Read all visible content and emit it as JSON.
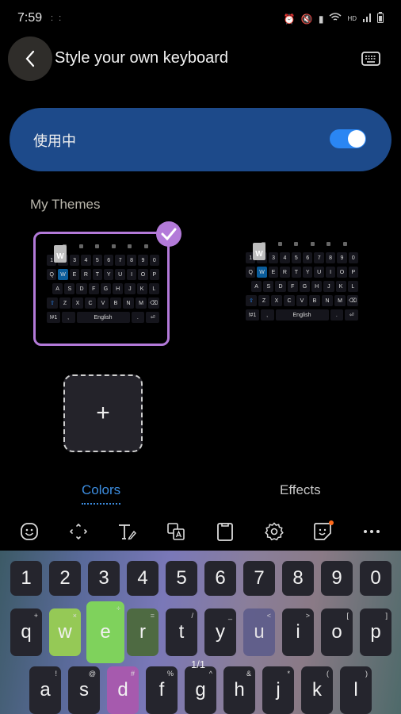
{
  "status_bar": {
    "time": "7:59",
    "notification_dots": ": :",
    "icons": [
      "alarm-icon",
      "mute-icon",
      "battery-saver-icon",
      "wifi-icon",
      "hd-icon",
      "signal-icon",
      "battery-icon"
    ],
    "hd_label": "HD"
  },
  "app_bar": {
    "title": "Style your own keyboard",
    "back_icon": "chevron-left-icon",
    "right_icon": "keyboard-icon"
  },
  "toggle": {
    "label": "使用中",
    "on": true
  },
  "my_themes": {
    "label": "My Themes",
    "themes": [
      {
        "selected": true,
        "popup_key": "W"
      },
      {
        "selected": false,
        "popup_key": "W"
      }
    ],
    "add_label": "+"
  },
  "mini_keyboard": {
    "rows": [
      [
        "1",
        "2",
        "3",
        "4",
        "5",
        "6",
        "7",
        "8",
        "9",
        "0"
      ],
      [
        "Q",
        "W",
        "E",
        "R",
        "T",
        "Y",
        "U",
        "I",
        "O",
        "P"
      ],
      [
        "A",
        "S",
        "D",
        "F",
        "G",
        "H",
        "J",
        "K",
        "L"
      ],
      [
        "⇧",
        "Z",
        "X",
        "C",
        "V",
        "B",
        "N",
        "M",
        "⌫"
      ],
      [
        "!#1",
        ",",
        "English",
        ".",
        "⏎"
      ]
    ]
  },
  "tabs": [
    {
      "label": "Colors",
      "active": true
    },
    {
      "label": "Effects",
      "active": false
    }
  ],
  "keyboard_toolbar": {
    "icons": [
      "emoji-icon",
      "cursor-move-icon",
      "text-edit-icon",
      "translate-icon",
      "clipboard-icon",
      "settings-icon",
      "sticker-icon",
      "more-icon"
    ]
  },
  "keyboard": {
    "number_row": [
      "1",
      "2",
      "3",
      "4",
      "5",
      "6",
      "7",
      "8",
      "9",
      "0"
    ],
    "row1": [
      {
        "key": "q",
        "sub": "+"
      },
      {
        "key": "w",
        "sub": "×"
      },
      {
        "key": "e",
        "sub": "÷"
      },
      {
        "key": "r",
        "sub": "="
      },
      {
        "key": "t",
        "sub": "/"
      },
      {
        "key": "y",
        "sub": "_"
      },
      {
        "key": "u",
        "sub": "<"
      },
      {
        "key": "i",
        "sub": ">"
      },
      {
        "key": "o",
        "sub": "["
      },
      {
        "key": "p",
        "sub": "]"
      }
    ],
    "row2": [
      {
        "key": "a",
        "sub": "!"
      },
      {
        "key": "s",
        "sub": "@"
      },
      {
        "key": "d",
        "sub": "#"
      },
      {
        "key": "f",
        "sub": "%"
      },
      {
        "key": "g",
        "sub": "^"
      },
      {
        "key": "h",
        "sub": "&"
      },
      {
        "key": "j",
        "sub": "*"
      },
      {
        "key": "k",
        "sub": "("
      },
      {
        "key": "l",
        "sub": ")"
      }
    ],
    "page_indicator": "1/1",
    "key_colors": {
      "w": "#95c956",
      "e": "#7fd25c",
      "r": "#4e6a42",
      "u": "#5a5a8a",
      "d": "#a65aae",
      "default": "#25252d"
    }
  },
  "colors": {
    "accent_blue": "#3c8de0",
    "toggle_card": "#1d4a8a",
    "selected_theme": "#b37ad9"
  }
}
